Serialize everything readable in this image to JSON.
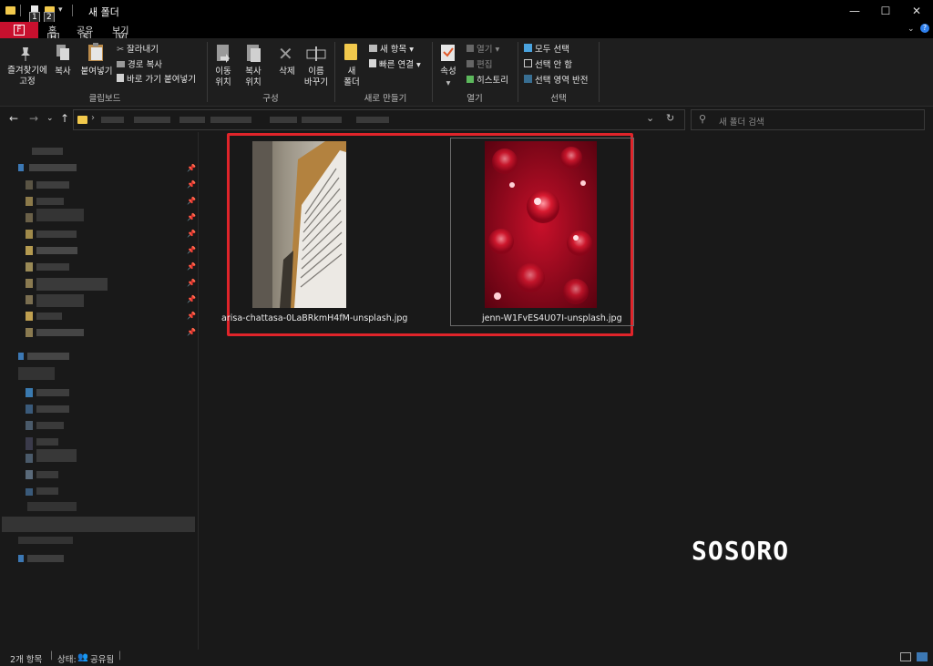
{
  "window": {
    "title": "새 폴더",
    "minimize": "—",
    "maximize": "☐",
    "close": "✕"
  },
  "keytips": {
    "quick1": "1",
    "quick2": "2",
    "file": "F",
    "home": "H",
    "share": "S",
    "view": "V"
  },
  "tabs": {
    "file": "F",
    "home": "홈",
    "share": "공유",
    "view": "보기"
  },
  "ribbon": {
    "clipboard": {
      "pin_quick": "즐겨찾기에\n고정",
      "copy": "복사",
      "paste": "붙여넣기",
      "cut": "잘라내기",
      "copy_path": "경로 복사",
      "paste_shortcut": "바로 가기 붙여넣기",
      "group": "클립보드"
    },
    "organize": {
      "move_to": "이동\n위치",
      "copy_to": "복사\n위치",
      "delete": "삭제",
      "rename": "이름\n바꾸기",
      "group": "구성"
    },
    "new": {
      "new_folder": "새\n폴더",
      "new_item": "새 항목",
      "easy_access": "빠른 연결",
      "group": "새로 만들기"
    },
    "open": {
      "properties": "속성",
      "open": "열기",
      "edit": "편집",
      "history": "히스토리",
      "group": "열기"
    },
    "select": {
      "select_all": "모두 선택",
      "select_none": "선택 안 함",
      "invert": "선택 영역 반전",
      "group": "선택"
    }
  },
  "address": {
    "search_placeholder": "새 폴더 검색"
  },
  "files": [
    {
      "name": "arisa-chattasa-0LaBRkmH4fM-unsplash.jpg"
    },
    {
      "name": "jenn-W1FvES4U07I-unsplash.jpg"
    }
  ],
  "watermark": "SOSORO",
  "status": {
    "count": "2개 항목",
    "state_label": "상태:",
    "state_value": "공유됨"
  },
  "colors": {
    "highlight": "#e0242a",
    "file_tab": "#c8102e",
    "folder": "#f2c94c"
  }
}
